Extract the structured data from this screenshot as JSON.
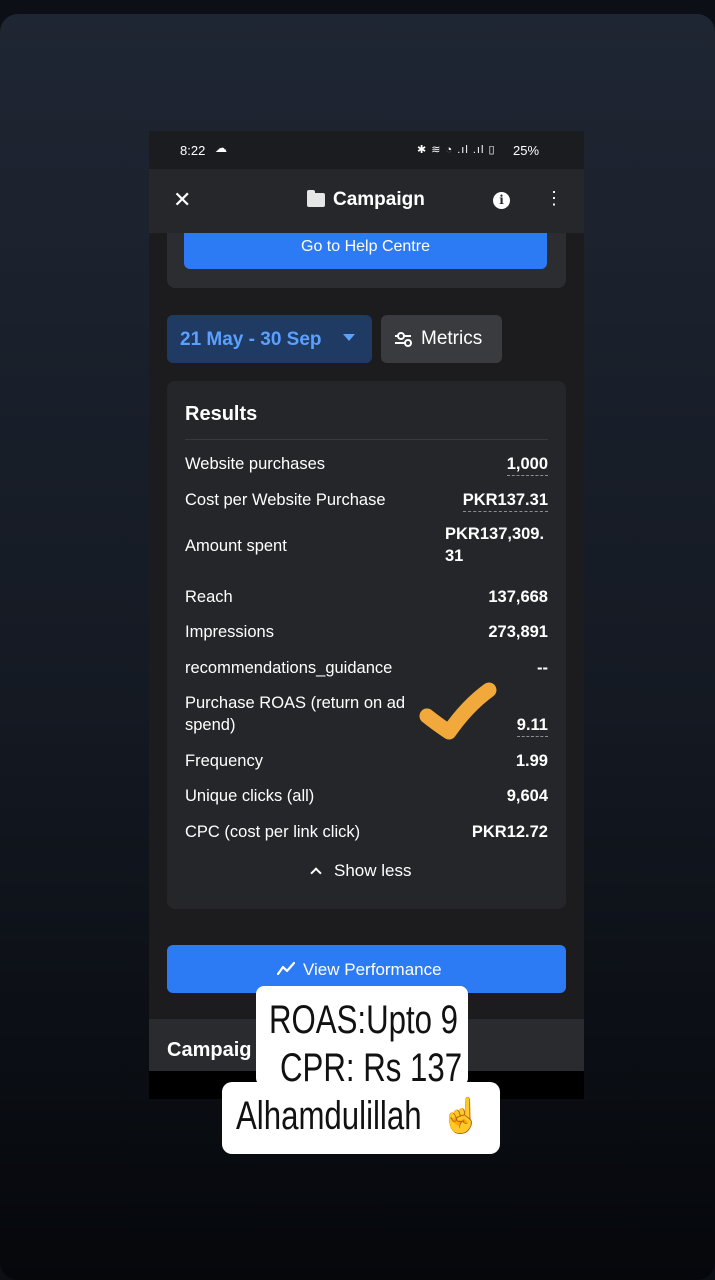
{
  "status_bar": {
    "time": "8:22",
    "battery": "25%",
    "icons": [
      "bluetooth-icon",
      "volte-icon",
      "wifi-icon",
      "signal-icon",
      "signal-icon",
      "battery-icon"
    ]
  },
  "app_bar": {
    "title": "Campaign",
    "icons": [
      "close-icon",
      "folder-icon",
      "info-icon",
      "more-vertical-icon"
    ]
  },
  "help": {
    "button_label": "Go to Help Centre"
  },
  "filters": {
    "date_range": "21 May - 30 Sep",
    "metrics_label": "Metrics"
  },
  "results": {
    "title": "Results",
    "rows": [
      {
        "label": "Website purchases",
        "value": "1,000"
      },
      {
        "label": "Cost per Website Purchase",
        "value": "PKR137.31"
      },
      {
        "label": "Amount spent",
        "value": "PKR137,309.\n31"
      },
      {
        "label": "Reach",
        "value": "137,668"
      },
      {
        "label": "Impressions",
        "value": "273,891"
      },
      {
        "label": "recommendations_guidance",
        "value": "--"
      },
      {
        "label": "Purchase ROAS (return on ad spend)",
        "value": "9.11"
      },
      {
        "label": "Frequency",
        "value": "1.99"
      },
      {
        "label": "Unique clicks (all)",
        "value": "9,604"
      },
      {
        "label": "CPC (cost per link click)",
        "value": "PKR12.72"
      }
    ],
    "show_less": "Show less"
  },
  "view_performance": {
    "label": "View Performance"
  },
  "campaigns_section": {
    "label": "Campaig"
  },
  "sticker": {
    "line1": "ROAS:Upto 9",
    "line2": "CPR: Rs 137",
    "line3": "Alhamdulillah",
    "emoji": "☝"
  },
  "colors": {
    "accent_blue": "#2d7bf4",
    "date_text": "#5aa1ff",
    "checkmark": "#f2a93b"
  }
}
